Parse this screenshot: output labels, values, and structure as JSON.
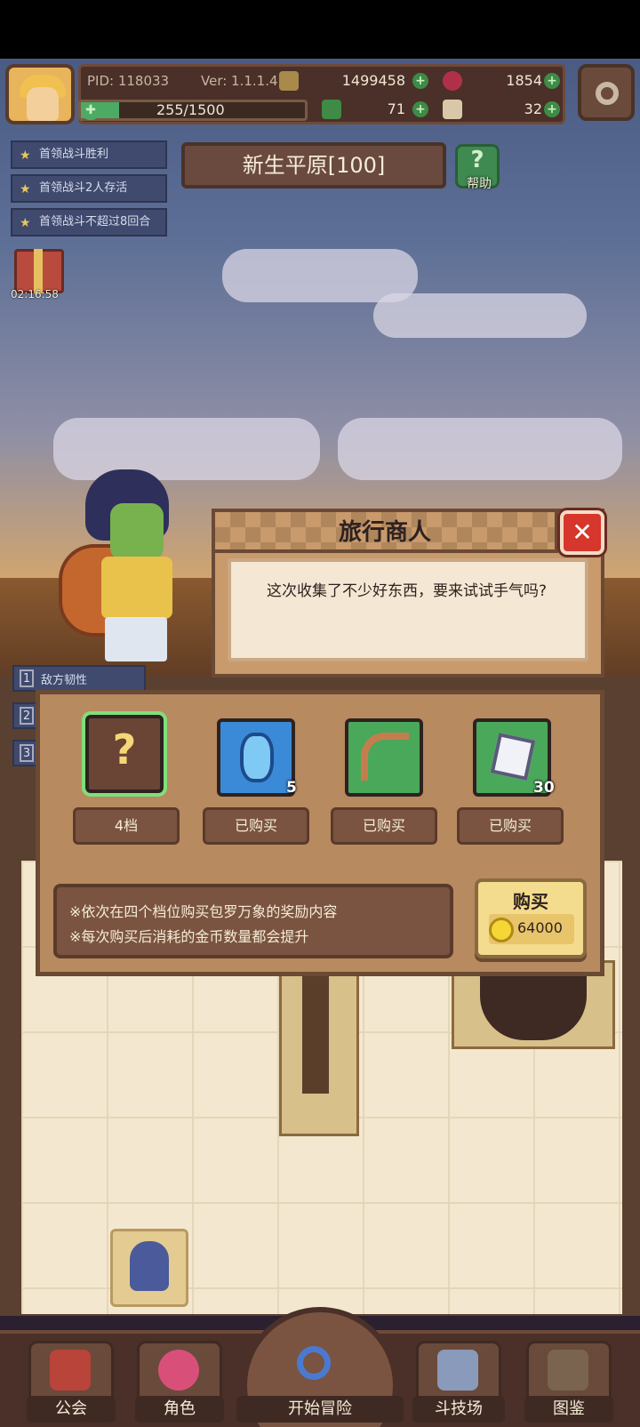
{
  "player": {
    "pid": "PID: 118033",
    "version": "Ver: 1.1.1.4",
    "gold": "1499458",
    "gems": "1854",
    "energy_text": "255/1500",
    "energy_fraction": 0.17,
    "clover": "71",
    "keys": "32"
  },
  "quests": [
    "首领战斗胜利",
    "首领战斗2人存活",
    "首领战斗不超过8回合"
  ],
  "stage": {
    "name": "新生平原[100]",
    "help_label": "帮助"
  },
  "gift_timer": "02:16:58",
  "buff_text": "敌方韧性",
  "buff_numbers": [
    "1",
    "2",
    "3"
  ],
  "dialog": {
    "title": "旅行商人",
    "message": "这次收集了不少好东西，要来试试手气吗?"
  },
  "shop": {
    "items": [
      {
        "icon": "mystery-icon",
        "label": "4档",
        "qty": ""
      },
      {
        "icon": "blue-gem-icon",
        "label": "已购买",
        "qty": "5"
      },
      {
        "icon": "bow-icon",
        "label": "已购买",
        "qty": ""
      },
      {
        "icon": "white-crystal-icon",
        "label": "已购买",
        "qty": "30"
      }
    ],
    "notes": [
      "※依次在四个档位购买包罗万象的奖励内容",
      "※每次购买后消耗的金币数量都会提升"
    ],
    "buy_label": "购买",
    "price": "64000"
  },
  "nav": {
    "guild": "公会",
    "characters": "角色",
    "adventure": "开始冒险",
    "arena": "斗技场",
    "codex": "图鉴"
  },
  "colors": {
    "selected_slot": "#7ee07a",
    "close_red": "#d6362c",
    "gold_coin": "#f5d634"
  }
}
